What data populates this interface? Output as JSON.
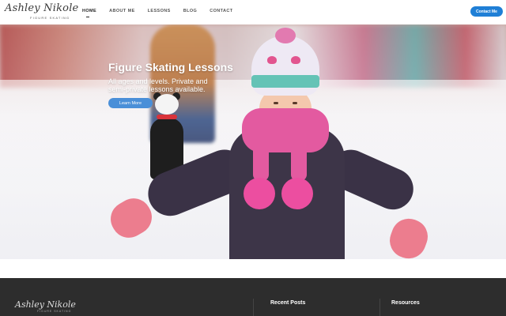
{
  "header": {
    "logo": {
      "script": "Ashley Nikole",
      "sub": "FIGURE SKATING"
    },
    "nav": [
      {
        "label": "HOME",
        "active": true
      },
      {
        "label": "ABOUT ME",
        "active": false
      },
      {
        "label": "LESSONS",
        "active": false
      },
      {
        "label": "BLOG",
        "active": false
      },
      {
        "label": "CONTACT",
        "active": false
      }
    ],
    "contact_button": "Contact Me"
  },
  "hero": {
    "title": "Figure Skating Lessons",
    "subtitle": "All ages and levels. Private and semi-private lessons available.",
    "button": "Learn More"
  },
  "footer": {
    "logo": {
      "script": "Ashley Nikole",
      "sub": "FIGURE SKATING"
    },
    "recent_posts": "Recent Posts",
    "resources": "Resources"
  },
  "colors": {
    "accent": "#1f7fd6",
    "footer_bg": "#2d2d2d"
  }
}
